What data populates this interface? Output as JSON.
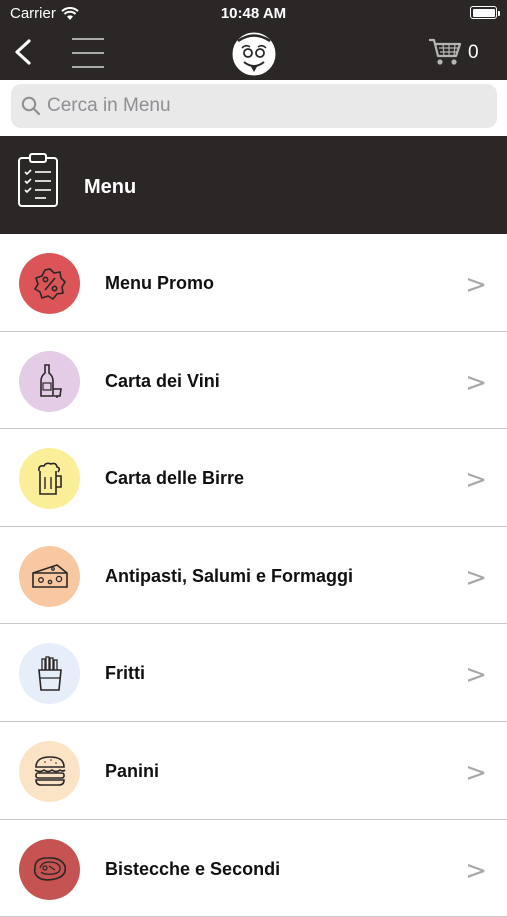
{
  "status_bar": {
    "carrier": "Carrier",
    "time": "10:48 AM"
  },
  "nav": {
    "cart_count": "0"
  },
  "search": {
    "placeholder": "Cerca in Menu"
  },
  "header": {
    "title": "Menu"
  },
  "categories": [
    {
      "label": "Menu Promo",
      "color": "#db5457",
      "icon": "percent-badge-icon"
    },
    {
      "label": "Carta dei Vini",
      "color": "#e4cce6",
      "icon": "wine-bottle-icon"
    },
    {
      "label": "Carta delle Birre",
      "color": "#fbee98",
      "icon": "beer-mug-icon"
    },
    {
      "label": "Antipasti, Salumi e Formaggi",
      "color": "#f8c8a3",
      "icon": "cheese-icon"
    },
    {
      "label": "Fritti",
      "color": "#e6eefa",
      "icon": "fries-icon"
    },
    {
      "label": "Panini",
      "color": "#fbe3c5",
      "icon": "burger-icon"
    },
    {
      "label": "Bistecche e Secondi",
      "color": "#c55352",
      "icon": "steak-icon"
    }
  ],
  "chevron": ">"
}
